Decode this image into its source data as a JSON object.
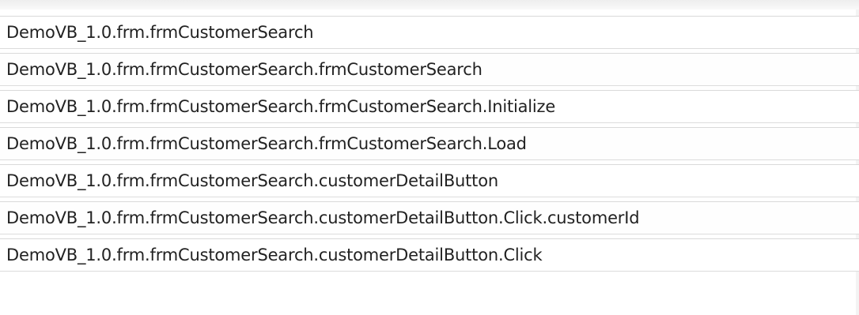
{
  "list": {
    "items": [
      {
        "label": "DemoVB_1.0.frm.frmCustomerSearch"
      },
      {
        "label": "DemoVB_1.0.frm.frmCustomerSearch.frmCustomerSearch"
      },
      {
        "label": "DemoVB_1.0.frm.frmCustomerSearch.frmCustomerSearch.Initialize"
      },
      {
        "label": "DemoVB_1.0.frm.frmCustomerSearch.frmCustomerSearch.Load"
      },
      {
        "label": "DemoVB_1.0.frm.frmCustomerSearch.customerDetailButton"
      },
      {
        "label": "DemoVB_1.0.frm.frmCustomerSearch.customerDetailButton.Click.customerId"
      },
      {
        "label": "DemoVB_1.0.frm.frmCustomerSearch.customerDetailButton.Click"
      }
    ]
  }
}
